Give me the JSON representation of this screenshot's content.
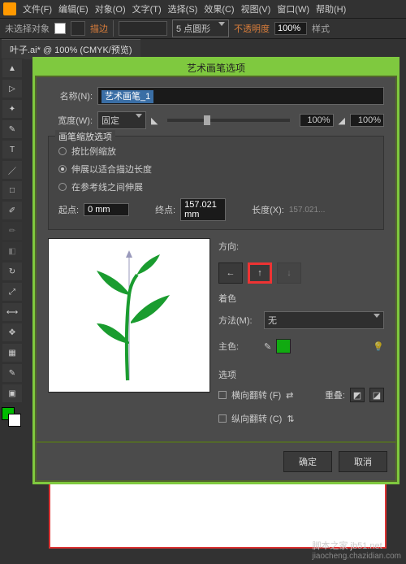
{
  "menu": {
    "file": "文件(F)",
    "edit": "编辑(E)",
    "object": "对象(O)",
    "type": "文字(T)",
    "select": "选择(S)",
    "effect": "效果(C)",
    "view": "视图(V)",
    "window": "窗口(W)",
    "help": "帮助(H)"
  },
  "controlbar": {
    "noselect": "未选择对象",
    "stroke": "描边",
    "strokeProfile": "5 点圆形",
    "opacity": "不透明度",
    "opacityVal": "100%",
    "style": "样式"
  },
  "tab": {
    "title": "叶子.ai* @ 100% (CMYK/预览)"
  },
  "dialog": {
    "title": "艺术画笔选项",
    "nameLabel": "名称(N):",
    "nameValue": "艺术画笔_1",
    "widthLabel": "宽度(W):",
    "widthMode": "固定",
    "widthPct": "100%",
    "widthPct2": "100%",
    "scaleGroup": "画笔缩放选项",
    "radio1": "按比例缩放",
    "radio2": "伸展以适合描边长度",
    "radio3": "在参考线之间伸展",
    "startLabel": "起点:",
    "startVal": "0 mm",
    "endLabel": "终点:",
    "endVal": "157.021 mm",
    "lengthLabel": "长度(X):",
    "lengthVal": "157.021...",
    "dirLabel": "方向:",
    "colorLabel": "着色",
    "methodLabel": "方法(M):",
    "methodVal": "无",
    "mainColorLabel": "主色:",
    "optionsLabel": "选项",
    "flipH": "横向翻转 (F)",
    "flipV": "纵向翻转 (C)",
    "overlap": "重叠:",
    "ok": "确定",
    "cancel": "取消"
  },
  "watermark": {
    "site": "脚本之家 jb51.net",
    "credit": "jiaocheng.chazidian.com"
  }
}
